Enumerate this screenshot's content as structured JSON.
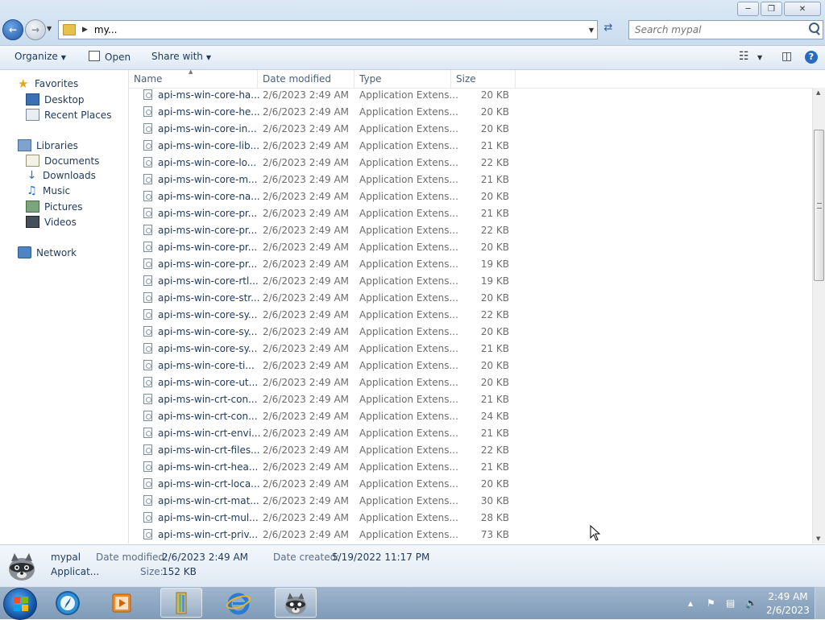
{
  "window": {
    "address_crumb": "my...",
    "search_placeholder": "Search mypal"
  },
  "toolbar": {
    "organize": "Organize",
    "open": "Open",
    "share_with": "Share with"
  },
  "nav": {
    "favorites": "Favorites",
    "desktop": "Desktop",
    "recent_places": "Recent Places",
    "libraries": "Libraries",
    "documents": "Documents",
    "downloads": "Downloads",
    "music": "Music",
    "pictures": "Pictures",
    "videos": "Videos",
    "network": "Network"
  },
  "columns": {
    "name": "Name",
    "date_modified": "Date modified",
    "type": "Type",
    "size": "Size"
  },
  "files": [
    {
      "name": "api-ms-win-core-ha...",
      "date": "2/6/2023 2:49 AM",
      "type": "Application Extens...",
      "size": "20 KB"
    },
    {
      "name": "api-ms-win-core-he...",
      "date": "2/6/2023 2:49 AM",
      "type": "Application Extens...",
      "size": "20 KB"
    },
    {
      "name": "api-ms-win-core-in...",
      "date": "2/6/2023 2:49 AM",
      "type": "Application Extens...",
      "size": "20 KB"
    },
    {
      "name": "api-ms-win-core-lib...",
      "date": "2/6/2023 2:49 AM",
      "type": "Application Extens...",
      "size": "21 KB"
    },
    {
      "name": "api-ms-win-core-lo...",
      "date": "2/6/2023 2:49 AM",
      "type": "Application Extens...",
      "size": "22 KB"
    },
    {
      "name": "api-ms-win-core-m...",
      "date": "2/6/2023 2:49 AM",
      "type": "Application Extens...",
      "size": "21 KB"
    },
    {
      "name": "api-ms-win-core-na...",
      "date": "2/6/2023 2:49 AM",
      "type": "Application Extens...",
      "size": "20 KB"
    },
    {
      "name": "api-ms-win-core-pr...",
      "date": "2/6/2023 2:49 AM",
      "type": "Application Extens...",
      "size": "21 KB"
    },
    {
      "name": "api-ms-win-core-pr...",
      "date": "2/6/2023 2:49 AM",
      "type": "Application Extens...",
      "size": "22 KB"
    },
    {
      "name": "api-ms-win-core-pr...",
      "date": "2/6/2023 2:49 AM",
      "type": "Application Extens...",
      "size": "20 KB"
    },
    {
      "name": "api-ms-win-core-pr...",
      "date": "2/6/2023 2:49 AM",
      "type": "Application Extens...",
      "size": "19 KB"
    },
    {
      "name": "api-ms-win-core-rtl...",
      "date": "2/6/2023 2:49 AM",
      "type": "Application Extens...",
      "size": "19 KB"
    },
    {
      "name": "api-ms-win-core-str...",
      "date": "2/6/2023 2:49 AM",
      "type": "Application Extens...",
      "size": "20 KB"
    },
    {
      "name": "api-ms-win-core-sy...",
      "date": "2/6/2023 2:49 AM",
      "type": "Application Extens...",
      "size": "22 KB"
    },
    {
      "name": "api-ms-win-core-sy...",
      "date": "2/6/2023 2:49 AM",
      "type": "Application Extens...",
      "size": "20 KB"
    },
    {
      "name": "api-ms-win-core-sy...",
      "date": "2/6/2023 2:49 AM",
      "type": "Application Extens...",
      "size": "21 KB"
    },
    {
      "name": "api-ms-win-core-ti...",
      "date": "2/6/2023 2:49 AM",
      "type": "Application Extens...",
      "size": "20 KB"
    },
    {
      "name": "api-ms-win-core-ut...",
      "date": "2/6/2023 2:49 AM",
      "type": "Application Extens...",
      "size": "20 KB"
    },
    {
      "name": "api-ms-win-crt-con...",
      "date": "2/6/2023 2:49 AM",
      "type": "Application Extens...",
      "size": "21 KB"
    },
    {
      "name": "api-ms-win-crt-con...",
      "date": "2/6/2023 2:49 AM",
      "type": "Application Extens...",
      "size": "24 KB"
    },
    {
      "name": "api-ms-win-crt-envi...",
      "date": "2/6/2023 2:49 AM",
      "type": "Application Extens...",
      "size": "21 KB"
    },
    {
      "name": "api-ms-win-crt-files...",
      "date": "2/6/2023 2:49 AM",
      "type": "Application Extens...",
      "size": "22 KB"
    },
    {
      "name": "api-ms-win-crt-hea...",
      "date": "2/6/2023 2:49 AM",
      "type": "Application Extens...",
      "size": "21 KB"
    },
    {
      "name": "api-ms-win-crt-loca...",
      "date": "2/6/2023 2:49 AM",
      "type": "Application Extens...",
      "size": "20 KB"
    },
    {
      "name": "api-ms-win-crt-mat...",
      "date": "2/6/2023 2:49 AM",
      "type": "Application Extens...",
      "size": "30 KB"
    },
    {
      "name": "api-ms-win-crt-mul...",
      "date": "2/6/2023 2:49 AM",
      "type": "Application Extens...",
      "size": "28 KB"
    },
    {
      "name": "api-ms-win-crt-priv...",
      "date": "2/6/2023 2:49 AM",
      "type": "Application Extens...",
      "size": "73 KB"
    }
  ],
  "details": {
    "name": "mypal",
    "type": "Applicat...",
    "date_modified_label": "Date modified:",
    "date_modified": "2/6/2023 2:49 AM",
    "date_created_label": "Date created:",
    "date_created": "5/19/2022 11:17 PM",
    "size_label": "Size:",
    "size": "152 KB"
  },
  "taskbar": {
    "clock_time": "2:49 AM",
    "clock_date": "2/6/2023"
  },
  "icons": {
    "back": "back-arrow-icon",
    "forward": "forward-arrow-icon",
    "search": "search-icon",
    "help": "help-icon",
    "file": "dll-file-icon"
  },
  "colors": {
    "accent": "#1e395b",
    "taskbar": "#8aa5c1"
  }
}
